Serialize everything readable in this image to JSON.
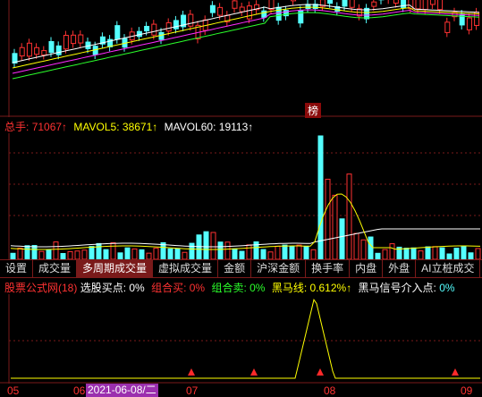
{
  "price_panel": {
    "badge": "榜"
  },
  "volume_panel": {
    "indicator_name": "总手:",
    "indicator_value": "71067↑",
    "mavol5_label": "MAVOL5:",
    "mavol5_value": "38671↑",
    "mavol60_label": "MAVOL60:",
    "mavol60_value": "19113↑",
    "colors": {
      "up": "#ff3232",
      "down": "#54ffff",
      "ma5": "#ffffff",
      "ma60": "#ffff00"
    }
  },
  "tabs": [
    {
      "label": "设置",
      "active": false
    },
    {
      "label": "成交量",
      "active": false
    },
    {
      "label": "多周期成交量",
      "active": true
    },
    {
      "label": "虚拟成交量",
      "active": false
    },
    {
      "label": "金额",
      "active": false
    },
    {
      "label": "沪深金额",
      "active": false
    },
    {
      "label": "换手率",
      "active": false
    },
    {
      "label": "内盘",
      "active": false
    },
    {
      "label": "外盘",
      "active": false
    },
    {
      "label": "AI立桩成交",
      "active": false
    }
  ],
  "signal_panel": {
    "source": "股票公式网(18)",
    "buy_point_label": "选股买点:",
    "buy_point_value": "0%",
    "combo_buy_label": "组合买:",
    "combo_buy_value": "0%",
    "combo_sell_label": "组合卖:",
    "combo_sell_value": "0%",
    "dark_horse_label": "黑马线:",
    "dark_horse_value": "0.612%↑",
    "dark_horse_signal_label": "黑马信号介入点:",
    "dark_horse_signal_value": "0%"
  },
  "x_axis": {
    "labels": [
      "05",
      "06",
      "07",
      "08",
      "09"
    ],
    "cursor_date": "2021-06-08/二"
  }
}
